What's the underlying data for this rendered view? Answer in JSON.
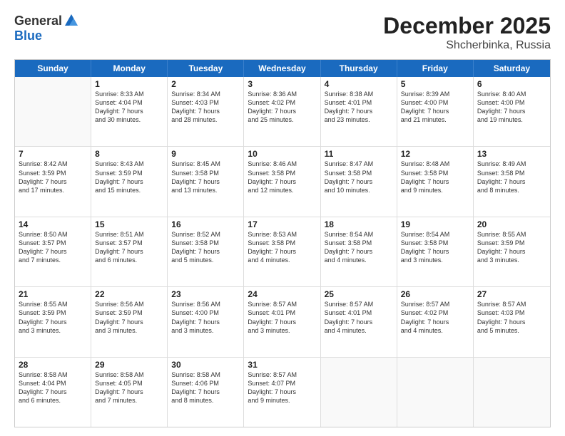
{
  "logo": {
    "general": "General",
    "blue": "Blue"
  },
  "header": {
    "title": "December 2025",
    "subtitle": "Shcherbinka, Russia"
  },
  "weekdays": [
    "Sunday",
    "Monday",
    "Tuesday",
    "Wednesday",
    "Thursday",
    "Friday",
    "Saturday"
  ],
  "weeks": [
    [
      {
        "day": "",
        "sunrise": "",
        "sunset": "",
        "daylight": ""
      },
      {
        "day": "1",
        "sunrise": "Sunrise: 8:33 AM",
        "sunset": "Sunset: 4:04 PM",
        "daylight": "Daylight: 7 hours",
        "daylight2": "and 30 minutes."
      },
      {
        "day": "2",
        "sunrise": "Sunrise: 8:34 AM",
        "sunset": "Sunset: 4:03 PM",
        "daylight": "Daylight: 7 hours",
        "daylight2": "and 28 minutes."
      },
      {
        "day": "3",
        "sunrise": "Sunrise: 8:36 AM",
        "sunset": "Sunset: 4:02 PM",
        "daylight": "Daylight: 7 hours",
        "daylight2": "and 25 minutes."
      },
      {
        "day": "4",
        "sunrise": "Sunrise: 8:38 AM",
        "sunset": "Sunset: 4:01 PM",
        "daylight": "Daylight: 7 hours",
        "daylight2": "and 23 minutes."
      },
      {
        "day": "5",
        "sunrise": "Sunrise: 8:39 AM",
        "sunset": "Sunset: 4:00 PM",
        "daylight": "Daylight: 7 hours",
        "daylight2": "and 21 minutes."
      },
      {
        "day": "6",
        "sunrise": "Sunrise: 8:40 AM",
        "sunset": "Sunset: 4:00 PM",
        "daylight": "Daylight: 7 hours",
        "daylight2": "and 19 minutes."
      }
    ],
    [
      {
        "day": "7",
        "sunrise": "Sunrise: 8:42 AM",
        "sunset": "Sunset: 3:59 PM",
        "daylight": "Daylight: 7 hours",
        "daylight2": "and 17 minutes."
      },
      {
        "day": "8",
        "sunrise": "Sunrise: 8:43 AM",
        "sunset": "Sunset: 3:59 PM",
        "daylight": "Daylight: 7 hours",
        "daylight2": "and 15 minutes."
      },
      {
        "day": "9",
        "sunrise": "Sunrise: 8:45 AM",
        "sunset": "Sunset: 3:58 PM",
        "daylight": "Daylight: 7 hours",
        "daylight2": "and 13 minutes."
      },
      {
        "day": "10",
        "sunrise": "Sunrise: 8:46 AM",
        "sunset": "Sunset: 3:58 PM",
        "daylight": "Daylight: 7 hours",
        "daylight2": "and 12 minutes."
      },
      {
        "day": "11",
        "sunrise": "Sunrise: 8:47 AM",
        "sunset": "Sunset: 3:58 PM",
        "daylight": "Daylight: 7 hours",
        "daylight2": "and 10 minutes."
      },
      {
        "day": "12",
        "sunrise": "Sunrise: 8:48 AM",
        "sunset": "Sunset: 3:58 PM",
        "daylight": "Daylight: 7 hours",
        "daylight2": "and 9 minutes."
      },
      {
        "day": "13",
        "sunrise": "Sunrise: 8:49 AM",
        "sunset": "Sunset: 3:58 PM",
        "daylight": "Daylight: 7 hours",
        "daylight2": "and 8 minutes."
      }
    ],
    [
      {
        "day": "14",
        "sunrise": "Sunrise: 8:50 AM",
        "sunset": "Sunset: 3:57 PM",
        "daylight": "Daylight: 7 hours",
        "daylight2": "and 7 minutes."
      },
      {
        "day": "15",
        "sunrise": "Sunrise: 8:51 AM",
        "sunset": "Sunset: 3:57 PM",
        "daylight": "Daylight: 7 hours",
        "daylight2": "and 6 minutes."
      },
      {
        "day": "16",
        "sunrise": "Sunrise: 8:52 AM",
        "sunset": "Sunset: 3:58 PM",
        "daylight": "Daylight: 7 hours",
        "daylight2": "and 5 minutes."
      },
      {
        "day": "17",
        "sunrise": "Sunrise: 8:53 AM",
        "sunset": "Sunset: 3:58 PM",
        "daylight": "Daylight: 7 hours",
        "daylight2": "and 4 minutes."
      },
      {
        "day": "18",
        "sunrise": "Sunrise: 8:54 AM",
        "sunset": "Sunset: 3:58 PM",
        "daylight": "Daylight: 7 hours",
        "daylight2": "and 4 minutes."
      },
      {
        "day": "19",
        "sunrise": "Sunrise: 8:54 AM",
        "sunset": "Sunset: 3:58 PM",
        "daylight": "Daylight: 7 hours",
        "daylight2": "and 3 minutes."
      },
      {
        "day": "20",
        "sunrise": "Sunrise: 8:55 AM",
        "sunset": "Sunset: 3:59 PM",
        "daylight": "Daylight: 7 hours",
        "daylight2": "and 3 minutes."
      }
    ],
    [
      {
        "day": "21",
        "sunrise": "Sunrise: 8:55 AM",
        "sunset": "Sunset: 3:59 PM",
        "daylight": "Daylight: 7 hours",
        "daylight2": "and 3 minutes."
      },
      {
        "day": "22",
        "sunrise": "Sunrise: 8:56 AM",
        "sunset": "Sunset: 3:59 PM",
        "daylight": "Daylight: 7 hours",
        "daylight2": "and 3 minutes."
      },
      {
        "day": "23",
        "sunrise": "Sunrise: 8:56 AM",
        "sunset": "Sunset: 4:00 PM",
        "daylight": "Daylight: 7 hours",
        "daylight2": "and 3 minutes."
      },
      {
        "day": "24",
        "sunrise": "Sunrise: 8:57 AM",
        "sunset": "Sunset: 4:01 PM",
        "daylight": "Daylight: 7 hours",
        "daylight2": "and 3 minutes."
      },
      {
        "day": "25",
        "sunrise": "Sunrise: 8:57 AM",
        "sunset": "Sunset: 4:01 PM",
        "daylight": "Daylight: 7 hours",
        "daylight2": "and 4 minutes."
      },
      {
        "day": "26",
        "sunrise": "Sunrise: 8:57 AM",
        "sunset": "Sunset: 4:02 PM",
        "daylight": "Daylight: 7 hours",
        "daylight2": "and 4 minutes."
      },
      {
        "day": "27",
        "sunrise": "Sunrise: 8:57 AM",
        "sunset": "Sunset: 4:03 PM",
        "daylight": "Daylight: 7 hours",
        "daylight2": "and 5 minutes."
      }
    ],
    [
      {
        "day": "28",
        "sunrise": "Sunrise: 8:58 AM",
        "sunset": "Sunset: 4:04 PM",
        "daylight": "Daylight: 7 hours",
        "daylight2": "and 6 minutes."
      },
      {
        "day": "29",
        "sunrise": "Sunrise: 8:58 AM",
        "sunset": "Sunset: 4:05 PM",
        "daylight": "Daylight: 7 hours",
        "daylight2": "and 7 minutes."
      },
      {
        "day": "30",
        "sunrise": "Sunrise: 8:58 AM",
        "sunset": "Sunset: 4:06 PM",
        "daylight": "Daylight: 7 hours",
        "daylight2": "and 8 minutes."
      },
      {
        "day": "31",
        "sunrise": "Sunrise: 8:57 AM",
        "sunset": "Sunset: 4:07 PM",
        "daylight": "Daylight: 7 hours",
        "daylight2": "and 9 minutes."
      },
      {
        "day": "",
        "sunrise": "",
        "sunset": "",
        "daylight": "",
        "daylight2": ""
      },
      {
        "day": "",
        "sunrise": "",
        "sunset": "",
        "daylight": "",
        "daylight2": ""
      },
      {
        "day": "",
        "sunrise": "",
        "sunset": "",
        "daylight": "",
        "daylight2": ""
      }
    ]
  ]
}
